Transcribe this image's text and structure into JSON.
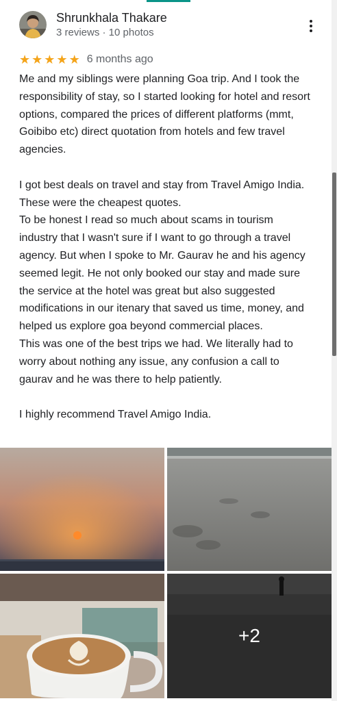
{
  "review": {
    "author": "Shrunkhala Thakare",
    "author_meta": "3 reviews · 10 photos",
    "rating": 5,
    "time_ago": "6 months ago",
    "paragraphs": [
      "Me and my siblings were planning Goa trip. And I took the responsibility of stay, so I started looking for hotel and resort options, compared the prices of different platforms (mmt, Goibibo etc) direct quotation from hotels and few travel agencies.",
      "",
      "I got best deals on travel and stay from Travel Amigo India. These were the cheapest quotes.",
      "To be honest I read so much about scams in tourism industry that I wasn't sure if I want to go through a travel agency. But when I spoke to Mr. Gaurav he and his agency seemed legit. He not only booked our stay and made sure the service at the hotel was great but also suggested modifications in our itenary that saved us time, money, and helped us explore goa beyond commercial places.",
      "This was one of the best trips we had. We literally had to worry about nothing any issue, any confusion a call to gaurav and he was there to help patiently.",
      "",
      "I highly recommend Travel Amigo India."
    ]
  },
  "photos": {
    "items": [
      "sunset-photo",
      "beach-footprints-photo",
      "latte-photo",
      "dark-beach-photo"
    ],
    "more_count": "+2"
  },
  "colors": {
    "star": "#f4a41a",
    "accent": "#0b9488"
  }
}
